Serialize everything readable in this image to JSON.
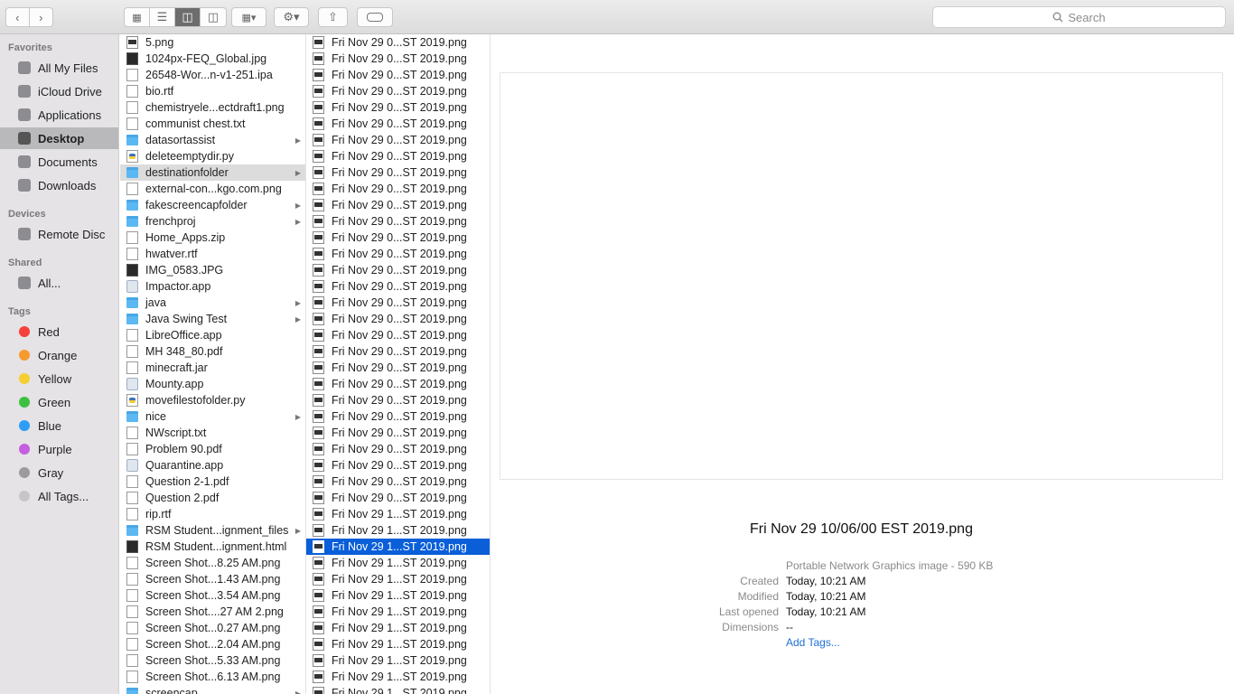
{
  "search": {
    "label": "Search"
  },
  "sidebar": {
    "favorites_heading": "Favorites",
    "favorites": [
      {
        "label": "All My Files",
        "icon": "all-files-icon"
      },
      {
        "label": "iCloud Drive",
        "icon": "cloud-icon"
      },
      {
        "label": "Applications",
        "icon": "applications-icon"
      },
      {
        "label": "Desktop",
        "icon": "desktop-icon",
        "selected": true
      },
      {
        "label": "Documents",
        "icon": "documents-icon"
      },
      {
        "label": "Downloads",
        "icon": "downloads-icon"
      }
    ],
    "devices_heading": "Devices",
    "devices": [
      {
        "label": "Remote Disc",
        "icon": "disc-icon"
      }
    ],
    "shared_heading": "Shared",
    "shared": [
      {
        "label": "All...",
        "icon": "network-icon"
      }
    ],
    "tags_heading": "Tags",
    "tags": [
      {
        "label": "Red",
        "color": "#f5403c"
      },
      {
        "label": "Orange",
        "color": "#f79a2e"
      },
      {
        "label": "Yellow",
        "color": "#f6ce2f"
      },
      {
        "label": "Green",
        "color": "#3dc040"
      },
      {
        "label": "Blue",
        "color": "#2e9df5"
      },
      {
        "label": "Purple",
        "color": "#c55fe0"
      },
      {
        "label": "Gray",
        "color": "#9b9b9b"
      },
      {
        "label": "All Tags...",
        "color": "#c7c5c8"
      }
    ]
  },
  "column1": [
    {
      "name": "5.png",
      "kind": "png"
    },
    {
      "name": "1024px-FEQ_Global.jpg",
      "kind": "dark"
    },
    {
      "name": "26548-Wor...n-v1-251.ipa",
      "kind": "doc"
    },
    {
      "name": "bio.rtf",
      "kind": "doc"
    },
    {
      "name": "chemistryele...ectdraft1.png",
      "kind": "doc"
    },
    {
      "name": "communist chest.txt",
      "kind": "doc"
    },
    {
      "name": "datasortassist",
      "kind": "folder",
      "arrow": true
    },
    {
      "name": "deleteemptydir.py",
      "kind": "py"
    },
    {
      "name": "destinationfolder",
      "kind": "folder",
      "arrow": true,
      "selected": true
    },
    {
      "name": "external-con...kgo.com.png",
      "kind": "doc"
    },
    {
      "name": "fakescreencapfolder",
      "kind": "folder",
      "arrow": true
    },
    {
      "name": "frenchproj",
      "kind": "folder",
      "arrow": true
    },
    {
      "name": "Home_Apps.zip",
      "kind": "doc"
    },
    {
      "name": "hwatver.rtf",
      "kind": "doc"
    },
    {
      "name": "IMG_0583.JPG",
      "kind": "dark"
    },
    {
      "name": "Impactor.app",
      "kind": "app"
    },
    {
      "name": "java",
      "kind": "folder",
      "arrow": true
    },
    {
      "name": "Java Swing Test",
      "kind": "folder",
      "arrow": true
    },
    {
      "name": "LibreOffice.app",
      "kind": "doc"
    },
    {
      "name": "MH 348_80.pdf",
      "kind": "doc"
    },
    {
      "name": "minecraft.jar",
      "kind": "doc"
    },
    {
      "name": "Mounty.app",
      "kind": "app"
    },
    {
      "name": "movefilestofolder.py",
      "kind": "py"
    },
    {
      "name": "nice",
      "kind": "folder",
      "arrow": true
    },
    {
      "name": "NWscript.txt",
      "kind": "doc"
    },
    {
      "name": "Problem 90.pdf",
      "kind": "doc"
    },
    {
      "name": "Quarantine.app",
      "kind": "app"
    },
    {
      "name": "Question 2-1.pdf",
      "kind": "doc"
    },
    {
      "name": "Question 2.pdf",
      "kind": "doc"
    },
    {
      "name": "rip.rtf",
      "kind": "doc"
    },
    {
      "name": "RSM Student...ignment_files",
      "kind": "folder",
      "arrow": true
    },
    {
      "name": "RSM Student...ignment.html",
      "kind": "dark"
    },
    {
      "name": "Screen Shot...8.25 AM.png",
      "kind": "doc"
    },
    {
      "name": "Screen Shot...1.43 AM.png",
      "kind": "doc"
    },
    {
      "name": "Screen Shot...3.54 AM.png",
      "kind": "doc"
    },
    {
      "name": "Screen Shot....27 AM 2.png",
      "kind": "doc"
    },
    {
      "name": "Screen Shot...0.27 AM.png",
      "kind": "doc"
    },
    {
      "name": "Screen Shot...2.04 AM.png",
      "kind": "doc"
    },
    {
      "name": "Screen Shot...5.33 AM.png",
      "kind": "doc"
    },
    {
      "name": "Screen Shot...6.13 AM.png",
      "kind": "doc"
    },
    {
      "name": "screencap",
      "kind": "folder",
      "arrow": true
    }
  ],
  "column2": [
    "Fri Nov 29 0...ST 2019.png",
    "Fri Nov 29 0...ST 2019.png",
    "Fri Nov 29 0...ST 2019.png",
    "Fri Nov 29 0...ST 2019.png",
    "Fri Nov 29 0...ST 2019.png",
    "Fri Nov 29 0...ST 2019.png",
    "Fri Nov 29 0...ST 2019.png",
    "Fri Nov 29 0...ST 2019.png",
    "Fri Nov 29 0...ST 2019.png",
    "Fri Nov 29 0...ST 2019.png",
    "Fri Nov 29 0...ST 2019.png",
    "Fri Nov 29 0...ST 2019.png",
    "Fri Nov 29 0...ST 2019.png",
    "Fri Nov 29 0...ST 2019.png",
    "Fri Nov 29 0...ST 2019.png",
    "Fri Nov 29 0...ST 2019.png",
    "Fri Nov 29 0...ST 2019.png",
    "Fri Nov 29 0...ST 2019.png",
    "Fri Nov 29 0...ST 2019.png",
    "Fri Nov 29 0...ST 2019.png",
    "Fri Nov 29 0...ST 2019.png",
    "Fri Nov 29 0...ST 2019.png",
    "Fri Nov 29 0...ST 2019.png",
    "Fri Nov 29 0...ST 2019.png",
    "Fri Nov 29 0...ST 2019.png",
    "Fri Nov 29 0...ST 2019.png",
    "Fri Nov 29 0...ST 2019.png",
    "Fri Nov 29 0...ST 2019.png",
    "Fri Nov 29 0...ST 2019.png",
    "Fri Nov 29 1...ST 2019.png",
    "Fri Nov 29 1...ST 2019.png",
    "Fri Nov 29 1...ST 2019.png",
    "Fri Nov 29 1...ST 2019.png",
    "Fri Nov 29 1...ST 2019.png",
    "Fri Nov 29 1...ST 2019.png",
    "Fri Nov 29 1...ST 2019.png",
    "Fri Nov 29 1...ST 2019.png",
    "Fri Nov 29 1...ST 2019.png",
    "Fri Nov 29 1...ST 2019.png",
    "Fri Nov 29 1...ST 2019.png",
    "Fri Nov 29 1...ST 2019.png"
  ],
  "column2_selected_index": 31,
  "preview": {
    "title": "Fri Nov 29 10/06/00 EST 2019.png",
    "kind": "Portable Network Graphics image - 590 KB",
    "created_label": "Created",
    "created": "Today, 10:21 AM",
    "modified_label": "Modified",
    "modified": "Today, 10:21 AM",
    "opened_label": "Last opened",
    "opened": "Today, 10:21 AM",
    "dimensions_label": "Dimensions",
    "dimensions": "--",
    "add_tags": "Add Tags..."
  }
}
